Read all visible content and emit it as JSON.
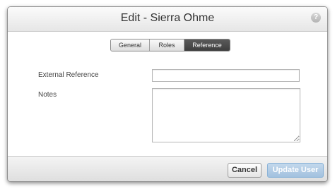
{
  "dialog": {
    "title": "Edit - Sierra Ohme",
    "help_icon": "question-mark-icon",
    "help_glyph": "?"
  },
  "tabs": [
    {
      "label": "General",
      "active": false
    },
    {
      "label": "Roles",
      "active": false
    },
    {
      "label": "Reference",
      "active": true
    }
  ],
  "form": {
    "external_reference": {
      "label": "External Reference",
      "value": ""
    },
    "notes": {
      "label": "Notes",
      "value": ""
    }
  },
  "footer": {
    "cancel_label": "Cancel",
    "update_label": "Update User",
    "update_disabled": true
  },
  "colors": {
    "active_tab": "#4a4a4a",
    "update_button": "#aac6e2"
  }
}
